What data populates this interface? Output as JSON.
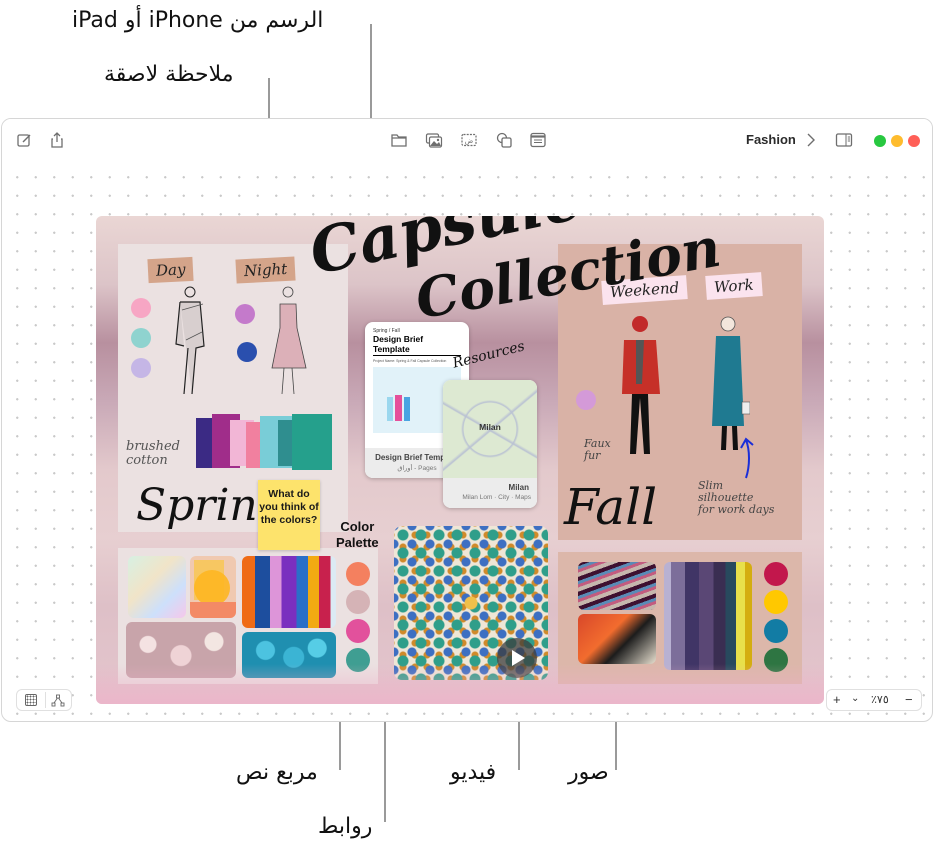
{
  "callouts": {
    "drawing": "الرسم من iPhone أو iPad",
    "sticky_note": "ملاحظة لاصقة",
    "text_box": "مربع نص",
    "links": "روابط",
    "video": "فيديو",
    "photos": "صور"
  },
  "window": {
    "title": "Fashion",
    "toolbar_left": [
      "compose-icon",
      "share-icon"
    ],
    "toolbar_center": [
      "folder-icon",
      "photo-icon",
      "text-box-icon",
      "shapes-icon",
      "sticky-note-icon"
    ],
    "toolbar_right": [
      "chevron-right-icon",
      "sidebar-icon"
    ],
    "traffic_lights": {
      "green": "#28c840",
      "yellow": "#febc2e",
      "red": "#ff5f57"
    }
  },
  "board": {
    "headline_line1": "Capsule",
    "headline_line2": "Collection",
    "spring": {
      "tag_day": "Day",
      "tag_night": "Night",
      "annotation_line1": "brushed",
      "annotation_line2": "cotton",
      "season": "Spring",
      "day_swatches": [
        "#f7a6c4",
        "#8fd3cf",
        "#c5b6e6"
      ],
      "night_swatches": [
        "#c47acb",
        "#2a4fae"
      ]
    },
    "fall": {
      "tag_weekend": "Weekend",
      "tag_work": "Work",
      "annotation_weekend_line1": "Faux",
      "annotation_weekend_line2": "fur",
      "annotation_work_line1": "Slim",
      "annotation_work_line2": "silhouette",
      "annotation_work_line3": "for work days",
      "season": "Fall",
      "swatch": "#d49ad8"
    },
    "sticky_note": {
      "text": "What do you think of the colors?"
    },
    "palette_label_line1": "Color",
    "palette_label_line2": "Palette",
    "spring_palette": [
      "#f4805f",
      "#d5b3b6",
      "#e2519c",
      "#3f9e92"
    ],
    "fall_palette": [
      "#c2174c",
      "#ffc800",
      "#127ca4",
      "#2e7542"
    ],
    "resources_label": "Resources",
    "doc_link": {
      "kicker": "Spring / Fall",
      "heading": "Design Brief Template",
      "project": "Project Name: Spring & Fall Capsule Collection",
      "footer_title": "Design Brief Template",
      "footer_sub": "Pages - أوراق"
    },
    "map_link": {
      "map_label": "Milan",
      "footer_title": "Milan",
      "footer_sub": "Milan Lom · City · Maps"
    }
  },
  "bottom_bar": {
    "zoom_in": "+",
    "zoom_menu": "⌄",
    "zoom_level": "٪٧٥",
    "zoom_out": "−"
  }
}
